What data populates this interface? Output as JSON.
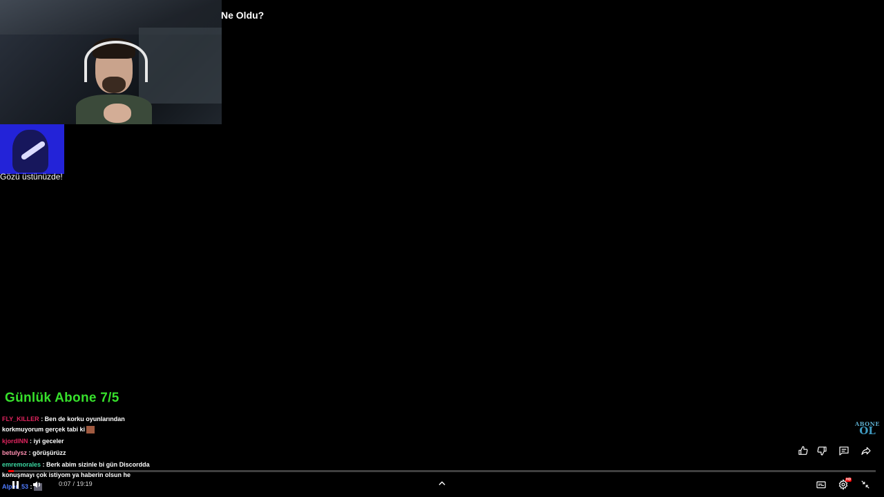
{
  "video": {
    "title": "Ne Oldu?",
    "time_current": "0:07",
    "time_separator": "/",
    "time_total": "19:19",
    "progress_fraction": 0.006
  },
  "overlay": {
    "alert_text": "Gözü üstünüzde!",
    "sub_goal": "Günlük Abone 7/5",
    "subscribe_line1": "ABONE",
    "subscribe_line2": "OL"
  },
  "chat": {
    "messages": [
      {
        "user": "FLY_KILLER",
        "color": "#e0245e",
        "text": " : Ben de korku oyunlarından korkmuyorum gerçek tabi ki",
        "emote": true
      },
      {
        "user": "kjordINN",
        "color": "#e0245e",
        "text": " : iyi geceler",
        "emote": false
      },
      {
        "user": "betulysz",
        "color": "#ff8fb1",
        "text": " : görüşürüzz",
        "emote": false
      },
      {
        "user": "emremorales",
        "color": "#3ad6a0",
        "text": " : Berk abim sizinle bi gün Discordda konuşmayı çok istiyom ya haberin olsun he",
        "emote": false
      },
      {
        "user": "Alper_53",
        "color": "#4f7bff",
        "text": " : ",
        "emote": true
      }
    ]
  },
  "controls": {
    "play_icon": "pause-icon",
    "volume_icon": "volume-icon",
    "expand_icon": "chevron-up-icon",
    "cc_icon": "subtitles-icon",
    "settings_icon": "gear-icon",
    "settings_badge": "HD",
    "fullscreen_icon": "exit-fullscreen-icon"
  },
  "actions": {
    "like_icon": "thumbs-up-icon",
    "dislike_icon": "thumbs-down-icon",
    "comment_icon": "comment-icon",
    "share_icon": "share-icon"
  },
  "colors": {
    "background": "#000000",
    "sub_goal": "#37e02c",
    "progress": "#ff0000",
    "alert_box": "#2323d8"
  }
}
